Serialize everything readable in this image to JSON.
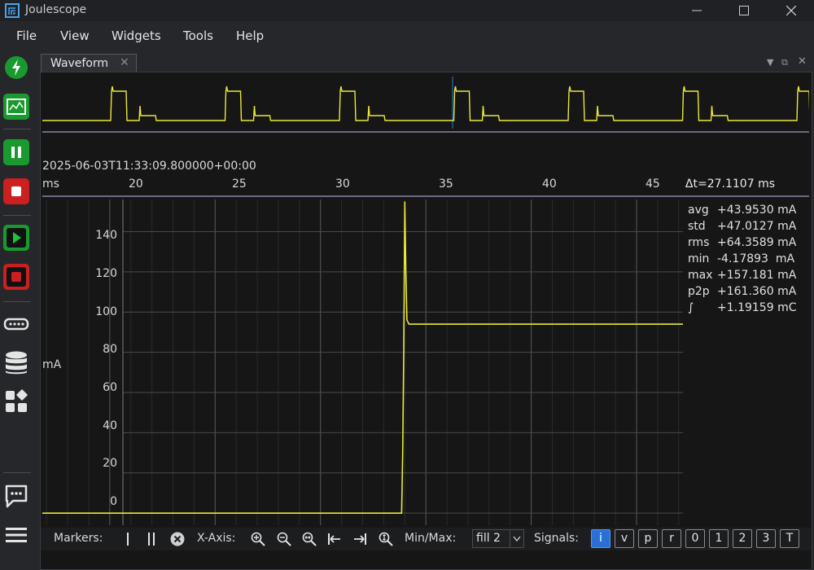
{
  "window": {
    "title": "Joulescope"
  },
  "menu": [
    "File",
    "View",
    "Widgets",
    "Tools",
    "Help"
  ],
  "tab": {
    "label": "Waveform"
  },
  "timestamp": "2025-06-03T11:33:09.800000+00:00",
  "x_axis": {
    "unit": "ms",
    "ticks": [
      "20",
      "25",
      "30",
      "35",
      "40",
      "45"
    ],
    "delta": "Δt=27.1107 ms"
  },
  "y_axis": {
    "unit": "mA",
    "ticks": [
      "140",
      "120",
      "100",
      "80",
      "60",
      "40",
      "20",
      "0"
    ]
  },
  "stats": [
    {
      "name": "avg",
      "value": "+43.9530 mA"
    },
    {
      "name": "std",
      "value": "+47.0127 mA"
    },
    {
      "name": "rms",
      "value": "+64.3589 mA"
    },
    {
      "name": "min",
      "value": "-4.17893  mA"
    },
    {
      "name": "max",
      "value": "+157.181 mA"
    },
    {
      "name": "p2p",
      "value": "+161.360 mA"
    },
    {
      "name": "∫",
      "value": "+1.19159 mC"
    }
  ],
  "toolbar": {
    "markers_label": "Markers:",
    "xaxis_label": "X-Axis:",
    "minmax_label": "Min/Max:",
    "minmax_value": "fill 2",
    "signals_label": "Signals:",
    "signals": [
      "i",
      "v",
      "p",
      "r",
      "0",
      "1",
      "2",
      "3",
      "T"
    ],
    "active_signal": "i"
  },
  "chart_data": {
    "type": "line",
    "xlabel": "ms",
    "ylabel": "mA",
    "xlim": [
      16.8,
      47.2
    ],
    "ylim": [
      -6,
      156
    ],
    "series": [
      {
        "x": [
          16.8,
          33.85,
          33.9,
          33.95,
          34.0,
          34.05,
          34.1,
          34.2,
          34.3,
          34.5,
          36.0,
          40.0,
          44.0,
          47.2
        ],
        "y": [
          0,
          0,
          30,
          80,
          155,
          120,
          96,
          94,
          94,
          94,
          94,
          94,
          94,
          94
        ]
      }
    ]
  },
  "colors": {
    "trace": "#e8e83a",
    "accent": "#2a6fd6",
    "axis_line": "#6d6880"
  }
}
